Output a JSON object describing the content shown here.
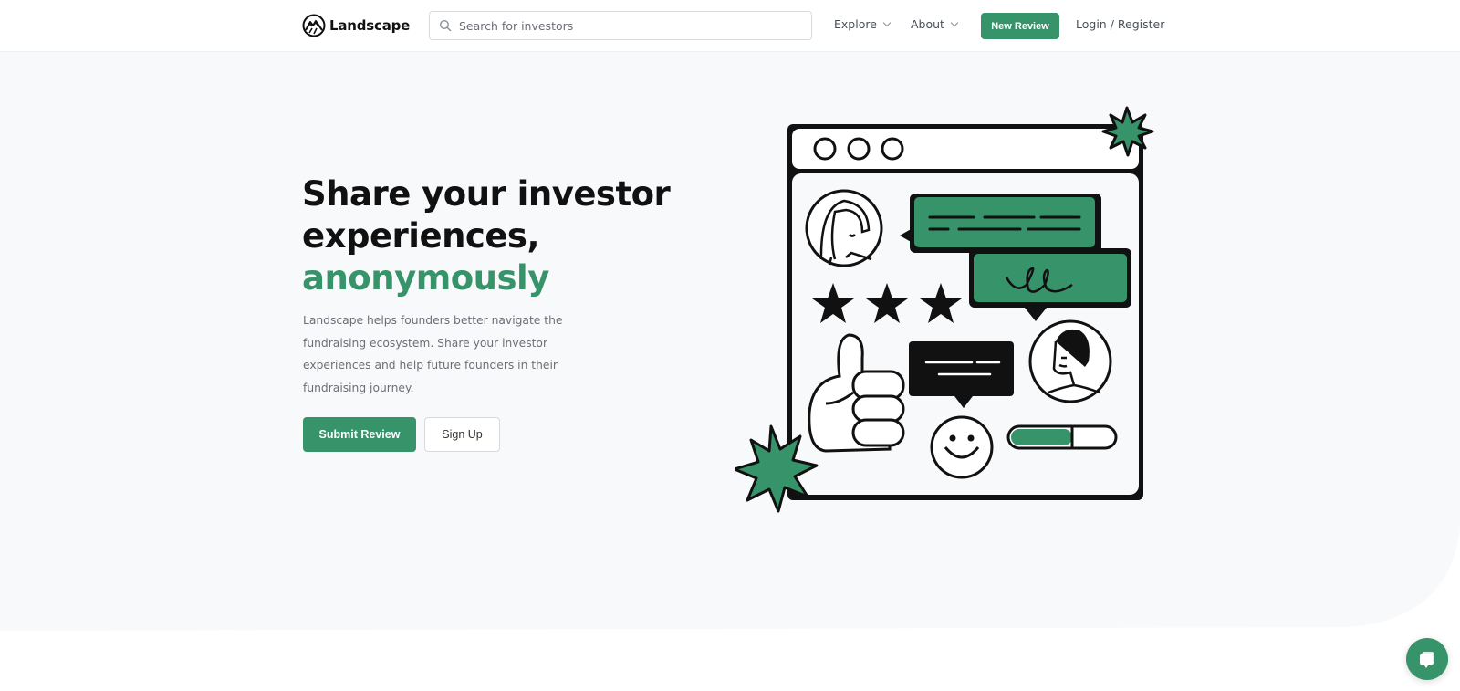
{
  "nav": {
    "brand": "Landscape",
    "search_placeholder": "Search for investors",
    "search_value": "",
    "explore_label": "Explore",
    "about_label": "About",
    "new_review_label": "New Review",
    "login_label": "Login / Register"
  },
  "hero": {
    "title_line1": "Share your investor",
    "title_line2": "experiences,",
    "title_accent": "anonymously",
    "description": "Landscape helps founders better navigate the fundraising ecosystem. Share your investor experiences and help future founders in their fundraising journey.",
    "submit_label": "Submit Review",
    "signup_label": "Sign Up"
  },
  "illustration": {
    "star_rating": 3,
    "progress_fraction": 0.6
  },
  "colors": {
    "brand_green": "#36936a",
    "hero_bg": "#f8f9fb",
    "text_dark": "#111111",
    "text_muted": "#6b6f76"
  },
  "icons": {
    "logo": "mountain-logo-icon",
    "search": "search-icon",
    "chevron": "chevron-down-icon",
    "chat": "chat-bubble-icon"
  }
}
